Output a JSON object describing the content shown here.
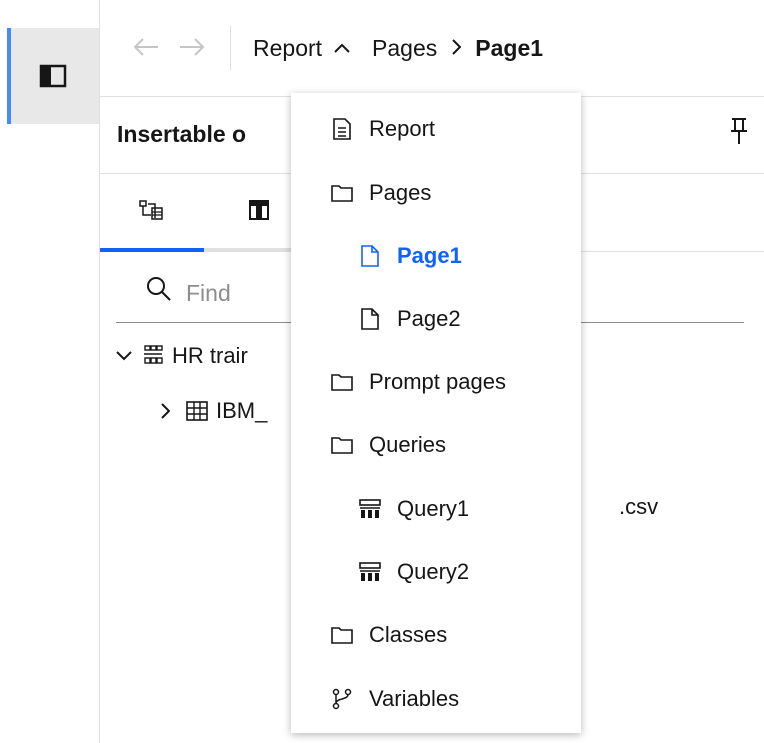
{
  "navigation": {
    "back_icon": "arrow-left-icon",
    "forward_icon": "arrow-right-icon",
    "breadcrumb": [
      {
        "label": "Report"
      },
      {
        "label": "Pages"
      },
      {
        "label": "Page1"
      }
    ]
  },
  "panel": {
    "title": "Insertable o",
    "search_placeholder": "Find",
    "tree": [
      {
        "label": "HR trair",
        "expanded": true
      },
      {
        "label": "IBM_",
        "suffix": ".csv",
        "expanded": false
      }
    ]
  },
  "menu": {
    "items": [
      {
        "label": "Report",
        "icon": "document-icon"
      },
      {
        "label": "Pages",
        "icon": "folder-icon"
      },
      {
        "label": "Page1",
        "icon": "page-icon",
        "selected": true
      },
      {
        "label": "Page2",
        "icon": "page-icon"
      },
      {
        "label": "Prompt pages",
        "icon": "folder-icon"
      },
      {
        "label": "Queries",
        "icon": "folder-icon"
      },
      {
        "label": "Query1",
        "icon": "query-icon"
      },
      {
        "label": "Query2",
        "icon": "query-icon"
      },
      {
        "label": "Classes",
        "icon": "folder-icon"
      },
      {
        "label": "Variables",
        "icon": "branch-icon"
      }
    ]
  },
  "colors": {
    "accent": "#0f62fe",
    "rail_indicator": "#4589ff",
    "rail_background": "#e8e8e8"
  }
}
